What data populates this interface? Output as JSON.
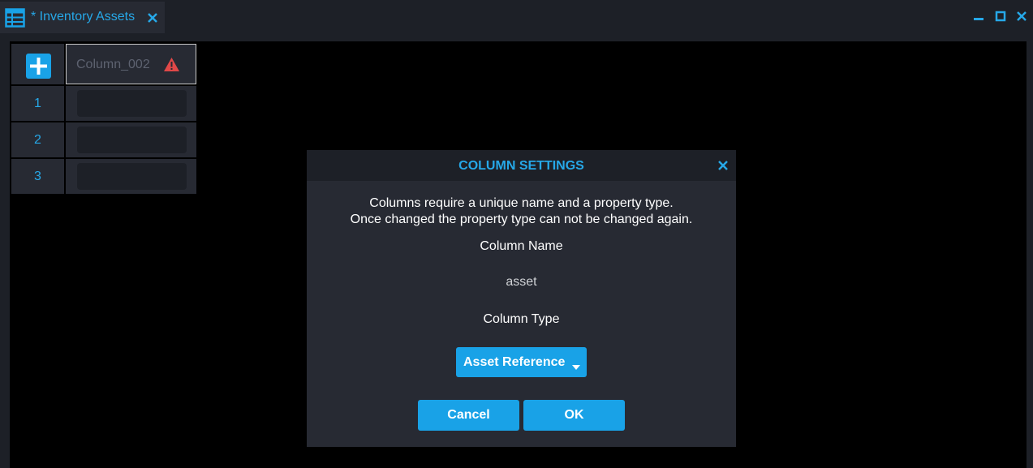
{
  "tab": {
    "title": "* Inventory Assets",
    "icon": "table-icon",
    "close_icon": "close-icon"
  },
  "window_controls": [
    "minimize-icon",
    "maximize-icon",
    "close-icon"
  ],
  "colors": {
    "accent": "#19a2e7",
    "accent_text": "#26a8e8",
    "panel": "#272a33",
    "background": "#1d2027",
    "warning": "#e04848"
  },
  "grid": {
    "add_icon": "plus-icon",
    "column_header": "Column_002",
    "header_status_icon": "warning-icon",
    "rows": [
      {
        "number": "1",
        "value": ""
      },
      {
        "number": "2",
        "value": ""
      },
      {
        "number": "3",
        "value": ""
      }
    ]
  },
  "dialog": {
    "title": "COLUMN SETTINGS",
    "description_line1": "Columns require a unique name and a property type.",
    "description_line2": "Once changed the property type can not be changed again.",
    "name_label": "Column Name",
    "name_value": "asset",
    "type_label": "Column Type",
    "type_value": "Asset Reference",
    "cancel_label": "Cancel",
    "ok_label": "OK"
  }
}
